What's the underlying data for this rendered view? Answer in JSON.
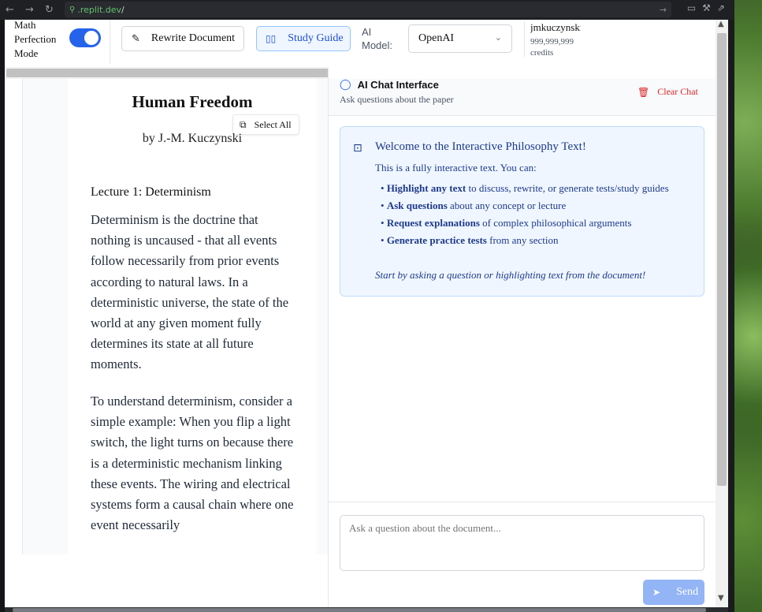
{
  "browser": {
    "url_host": ".replit.dev",
    "url_path": "/",
    "back_icon": "←",
    "forward_icon": "→",
    "reload_icon": "↻"
  },
  "toolbar": {
    "math_mode_label": "Math Perfection Mode",
    "math_mode_on": true,
    "rewrite_label": "Rewrite Document",
    "study_guide_label": "Study Guide",
    "ai_model_label": "AI Model:",
    "ai_model_value": "OpenAI",
    "username": "jmkuczynski",
    "credits": "999,999,999 credits"
  },
  "document": {
    "title": "Human Freedom",
    "author": "by J.-M. Kuczynski",
    "select_all_label": "Select All",
    "lecture_heading": "Lecture 1: Determinism",
    "paragraphs": [
      "Determinism is the doctrine that nothing is uncaused - that all events follow necessarily from prior events according to natural laws. In a deterministic universe, the state of the world at any given moment fully determines its state at all future moments.",
      "To understand determinism, consider a simple example: When you flip a light switch, the light turns on because there is a deterministic mechanism linking these events. The wiring and electrical systems form a causal chain where one event necessarily"
    ]
  },
  "chat": {
    "title": "AI Chat Interface",
    "subtitle": "Ask questions about the paper",
    "clear_label": "Clear Chat",
    "welcome_title": "Welcome to the Interactive Philosophy Text!",
    "welcome_intro": "This is a fully interactive text. You can:",
    "features": [
      {
        "bold": "Highlight any text",
        "rest": " to discuss, rewrite, or generate tests/study guides"
      },
      {
        "bold": "Ask questions",
        "rest": " about any concept or lecture"
      },
      {
        "bold": "Request explanations",
        "rest": " of complex philosophical arguments"
      },
      {
        "bold": "Generate practice tests",
        "rest": " from any section"
      }
    ],
    "welcome_cta": "Start by asking a question or highlighting text from the document!",
    "input_placeholder": "Ask a question about the document...",
    "send_label": "Send"
  },
  "colors": {
    "accent": "#2563eb",
    "danger": "#dc2626",
    "welcome_bg": "#eff6ff",
    "send_disabled": "#93b4f5"
  }
}
